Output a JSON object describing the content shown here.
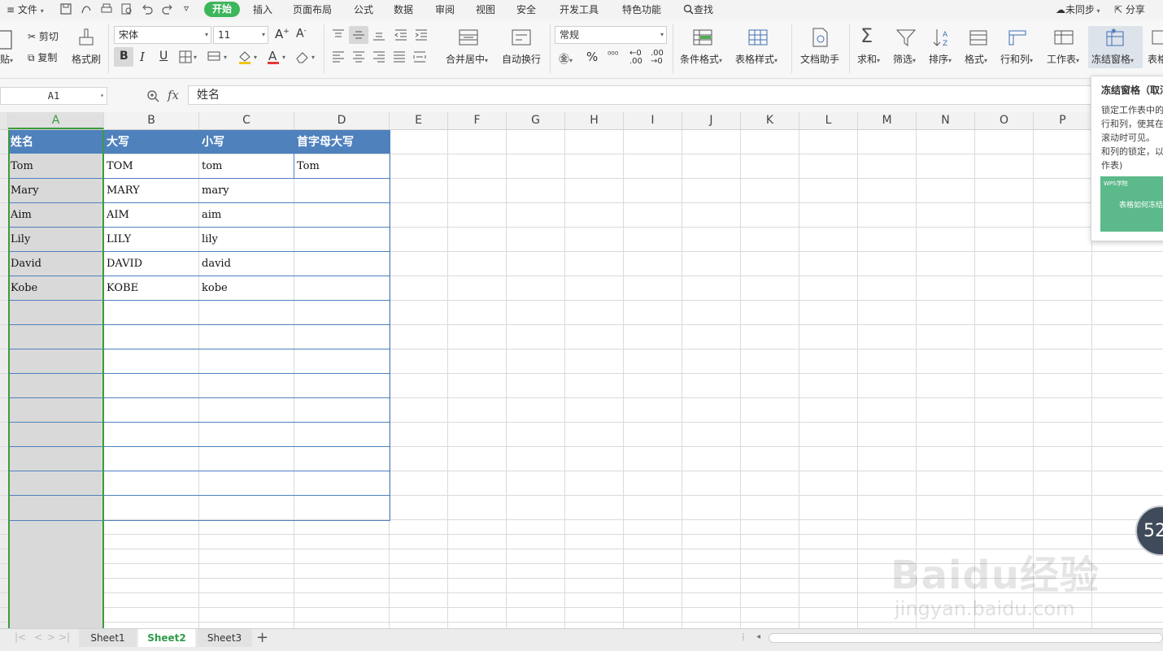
{
  "menubar": {
    "file": "文件",
    "tabs": [
      "开始",
      "插入",
      "页面布局",
      "公式",
      "数据",
      "审阅",
      "视图",
      "安全",
      "开发工具",
      "特色功能"
    ],
    "search": "查找",
    "sync": "未同步",
    "share": "分享"
  },
  "ribbon": {
    "paste_partial": "贴",
    "cut": "剪切",
    "copy": "复制",
    "format_painter": "格式刷",
    "font_name": "宋体",
    "font_size": "11",
    "merge_center": "合并居中",
    "wrap_text": "自动换行",
    "number_format": "常规",
    "conditional_format": "条件格式",
    "table_style": "表格样式",
    "doc_assistant": "文档助手",
    "sum": "求和",
    "filter": "筛选",
    "sort": "排序",
    "format": "格式",
    "row_col": "行和列",
    "worksheet": "工作表",
    "freeze_panes": "冻结窗格",
    "table_partial": "表格"
  },
  "formula_bar": {
    "name_box": "A1",
    "fx": "fx",
    "value": "姓名"
  },
  "grid": {
    "columns": [
      "A",
      "B",
      "C",
      "D",
      "E",
      "F",
      "G",
      "H",
      "I",
      "J",
      "K",
      "L",
      "M",
      "N",
      "O",
      "P"
    ],
    "header_row": [
      "姓名",
      "大写",
      "小写",
      "首字母大写"
    ],
    "rows": [
      [
        "Tom",
        "TOM",
        "tom",
        "Tom"
      ],
      [
        "Mary",
        "MARY",
        "mary",
        ""
      ],
      [
        "Aim",
        "AIM",
        "aim",
        ""
      ],
      [
        "Lily",
        "LILY",
        "lily",
        ""
      ],
      [
        "David",
        "DAVID",
        "david",
        ""
      ],
      [
        "Kobe",
        "KOBE",
        "kobe",
        ""
      ]
    ],
    "header_color": "#4f81bd",
    "selected_column_fill": "#d9d9d9",
    "selection_border": "#3c9b3c"
  },
  "sheet_tabs": [
    "Sheet1",
    "Sheet2",
    "Sheet3"
  ],
  "active_sheet": "Sheet2",
  "tooltip": {
    "title": "冻结窗格（取消",
    "body_lines": [
      "锁定工作表中的",
      "行和列，使其在",
      "滚动时可见。",
      "和列的锁定，以",
      "作表)"
    ],
    "thumb_brand": "WPS学院",
    "thumb_caption": "表格如何冻结"
  },
  "floating_badge": "52",
  "watermark": {
    "brand": "Baidu经验",
    "url": "jingyan.baidu.com"
  }
}
